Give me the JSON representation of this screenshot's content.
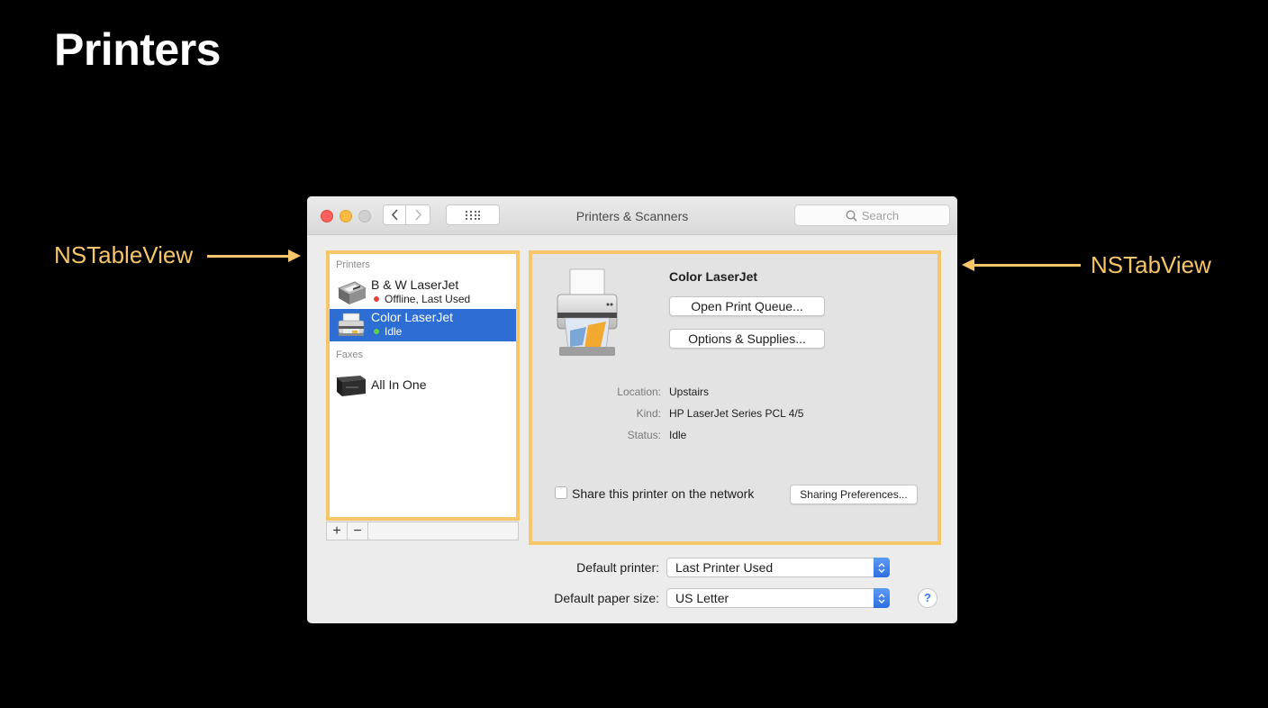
{
  "slide": {
    "title": "Printers",
    "callout_left": "NSTableView",
    "callout_right": "NSTabView"
  },
  "window": {
    "title": "Printers & Scanners",
    "search_placeholder": "Search"
  },
  "sidebar": {
    "printers_header": "Printers",
    "faxes_header": "Faxes",
    "items": [
      {
        "name": "B & W LaserJet",
        "status": "Offline, Last Used",
        "status_color": "#e2443d"
      },
      {
        "name": "Color LaserJet",
        "status": "Idle",
        "status_color": "#5fce4b",
        "selected": true
      },
      {
        "name": "All In One"
      }
    ],
    "add_label": "+",
    "remove_label": "−"
  },
  "detail": {
    "printer_name": "Color LaserJet",
    "open_queue_label": "Open Print Queue...",
    "options_label": "Options & Supplies...",
    "location_label": "Location:",
    "location_value": "Upstairs",
    "kind_label": "Kind:",
    "kind_value": "HP LaserJet Series PCL 4/5",
    "status_label": "Status:",
    "status_value": "Idle",
    "share_label": "Share this printer on the network",
    "share_checked": false,
    "sharing_prefs_label": "Sharing Preferences..."
  },
  "bottom": {
    "default_printer_label": "Default printer:",
    "default_printer_value": "Last Printer Used",
    "paper_size_label": "Default paper size:",
    "paper_size_value": "US Letter",
    "help_label": "?"
  },
  "colors": {
    "accent": "#f7c56a",
    "selection": "#2c6ed4"
  }
}
